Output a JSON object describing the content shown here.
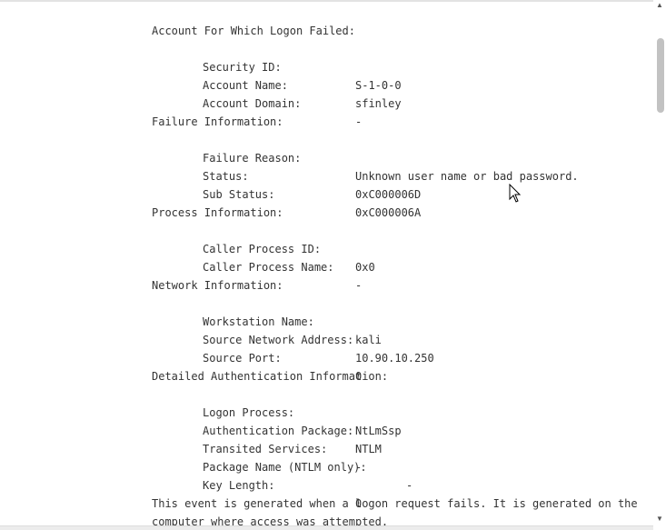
{
  "event": {
    "account": {
      "heading": "Account For Which Logon Failed:",
      "fields": [
        {
          "label": "Security ID:",
          "value": "S-1-0-0"
        },
        {
          "label": "Account Name:",
          "value": "sfinley"
        },
        {
          "label": "Account Domain:",
          "value": "-"
        }
      ]
    },
    "failure": {
      "heading": "Failure Information:",
      "fields": [
        {
          "label": "Failure Reason:",
          "value": "Unknown user name or bad password."
        },
        {
          "label": "Status:",
          "value": "0xC000006D"
        },
        {
          "label": "Sub Status:",
          "value": "0xC000006A"
        }
      ]
    },
    "process": {
      "heading": "Process Information:",
      "fields": [
        {
          "label": "Caller Process ID:",
          "value": "0x0"
        },
        {
          "label": "Caller Process Name:",
          "value": "-"
        }
      ]
    },
    "network": {
      "heading": "Network Information:",
      "fields": [
        {
          "label": "Workstation Name:",
          "value": "kali"
        },
        {
          "label": "Source Network Address:",
          "value": "10.90.10.250"
        },
        {
          "label": "Source Port:",
          "value": "0"
        }
      ]
    },
    "auth": {
      "heading": "Detailed Authentication Information:",
      "fields": [
        {
          "label": "Logon Process:",
          "value": "NtLmSsp"
        },
        {
          "label": "Authentication Package:",
          "value": "NTLM"
        },
        {
          "label": "Transited Services:",
          "value": "-"
        },
        {
          "label": "Package Name (NTLM only):",
          "value": "-"
        },
        {
          "label": "Key Length:",
          "value": "0"
        }
      ]
    },
    "description": "This event is generated when a logon request fails. It is generated on the computer where access was attempted."
  },
  "scrollbar": {
    "up_glyph": "▲",
    "down_glyph": "▼"
  }
}
